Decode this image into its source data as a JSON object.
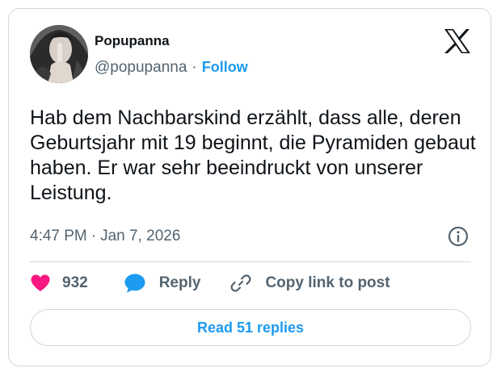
{
  "author": {
    "display_name": "Popupanna",
    "handle": "@popupanna",
    "separator": "·",
    "follow_label": "Follow"
  },
  "tweet": {
    "text": "Hab dem Nachbarskind erzählt, dass alle, deren Geburtsjahr mit 19 beginnt, die Pyramiden gebaut haben. Er war sehr beeindruckt von unserer Leistung.",
    "time": "4:47 PM",
    "dot": "·",
    "date": "Jan 7, 2026"
  },
  "actions": {
    "like_count": "932",
    "reply_label": "Reply",
    "copy_label": "Copy link to post"
  },
  "footer": {
    "read_replies_label": "Read 51 replies"
  },
  "icons": {
    "brand": "x-logo-icon",
    "info": "info-icon",
    "like": "heart-icon",
    "reply": "speech-bubble-icon",
    "copy": "link-icon"
  },
  "colors": {
    "accent": "#1d9bf0",
    "like": "#f91880",
    "muted": "#536471",
    "text": "#0f1419",
    "border": "#cfd9de"
  }
}
